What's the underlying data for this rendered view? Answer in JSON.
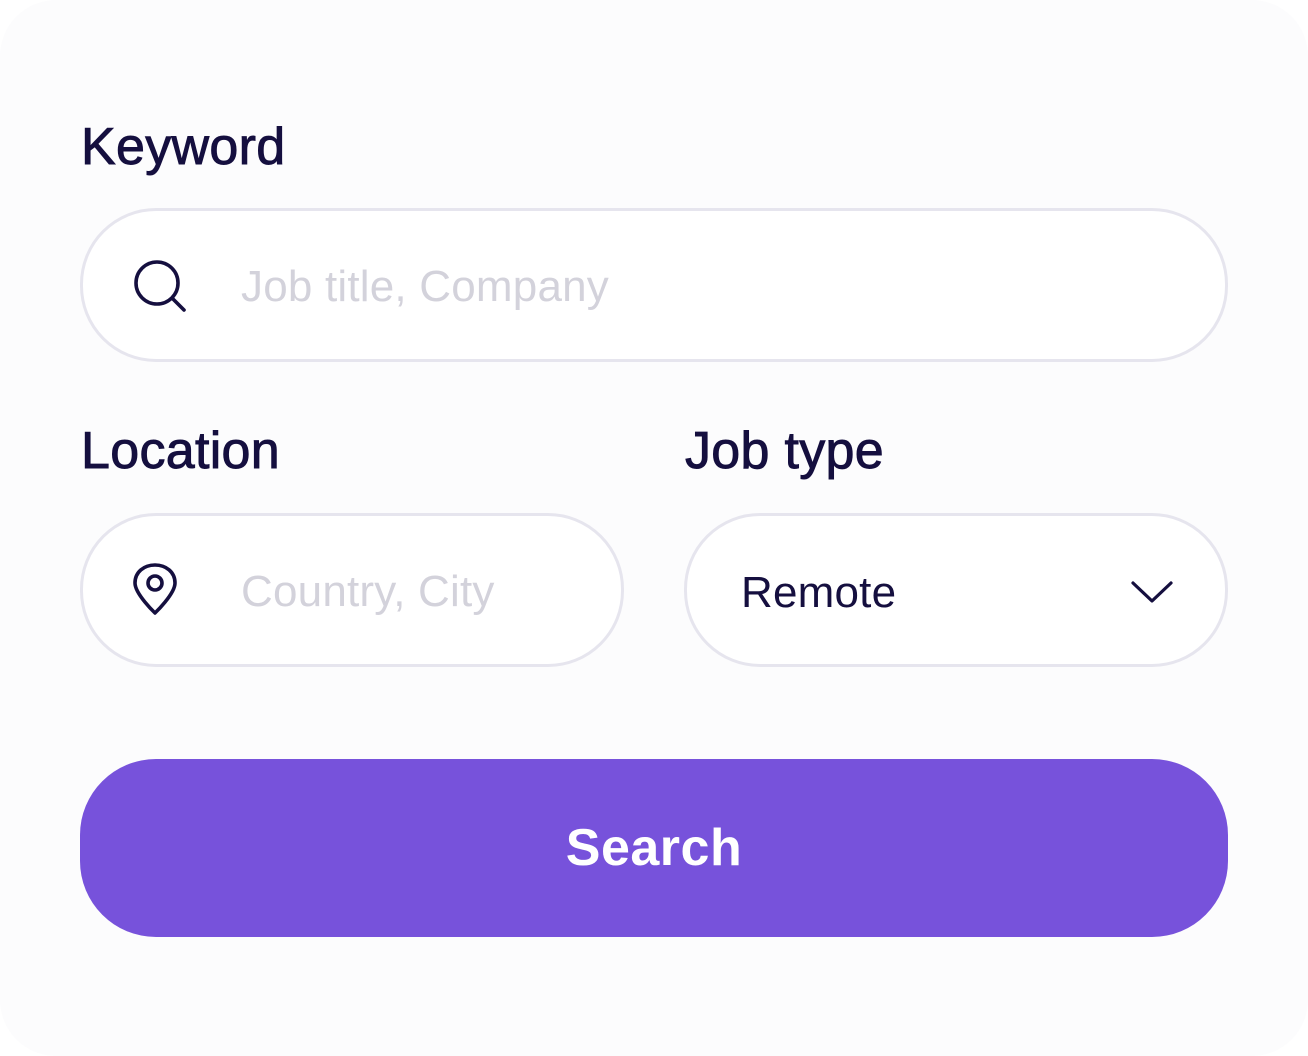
{
  "form": {
    "keyword": {
      "label": "Keyword",
      "placeholder": "Job title, Company",
      "value": "",
      "icon": "search-icon"
    },
    "location": {
      "label": "Location",
      "placeholder": "Country, City",
      "value": "",
      "icon": "map-pin-icon"
    },
    "job_type": {
      "label": "Job type",
      "selected": "Remote",
      "icon": "chevron-down-icon"
    },
    "search_button": {
      "label": "Search"
    }
  },
  "colors": {
    "text": "#150f3f",
    "placeholder": "#d3d2db",
    "border": "#e6e5ee",
    "accent": "#7752db",
    "card_background": "#fcfcfd"
  }
}
